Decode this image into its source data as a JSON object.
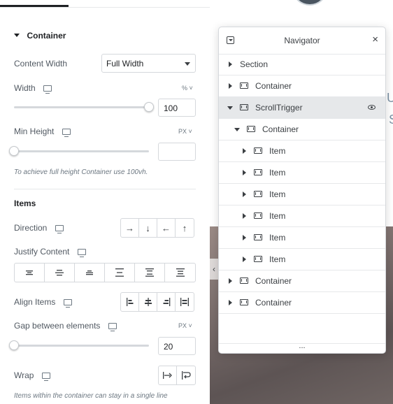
{
  "panel": {
    "section_title": "Container",
    "content_width": {
      "label": "Content Width",
      "value": "Full Width"
    },
    "width": {
      "label": "Width",
      "unit": "%",
      "value": "100",
      "slider_fraction": 1.0
    },
    "min_height": {
      "label": "Min Height",
      "unit": "PX",
      "value": "",
      "slider_fraction": 0.0
    },
    "min_height_hint": "To achieve full height Container use 100vh.",
    "items_title": "Items",
    "direction_label": "Direction",
    "direction_icons": [
      "arrow-right-icon",
      "arrow-down-icon",
      "arrow-left-icon",
      "arrow-up-icon"
    ],
    "direction_glyphs": [
      "→",
      "↓",
      "←",
      "↑"
    ],
    "justify_label": "Justify Content",
    "justify_icons": [
      "justify-start-icon",
      "justify-center-icon",
      "justify-end-icon",
      "justify-space-between-icon",
      "justify-space-around-icon",
      "justify-space-evenly-icon"
    ],
    "align_label": "Align Items",
    "align_icons": [
      "align-start-icon",
      "align-center-icon",
      "align-end-icon",
      "align-stretch-icon"
    ],
    "gap_label": "Gap between elements",
    "gap": {
      "unit": "PX",
      "value": "20",
      "slider_fraction": 0.0
    },
    "wrap_label": "Wrap",
    "wrap_icons": [
      "no-wrap-icon",
      "wrap-icon"
    ],
    "wrap_hint": "Items within the container can stay in a single line"
  },
  "navigator": {
    "title": "Navigator",
    "close": "×",
    "more": "...",
    "rows": [
      {
        "label": "Section",
        "expanded": false
      },
      {
        "label": "Container",
        "expanded": false
      },
      {
        "label": "ScrollTrigger",
        "expanded": true,
        "active": true
      },
      {
        "label": "Container",
        "expanded": true
      },
      {
        "label": "Item",
        "expanded": false
      },
      {
        "label": "Item",
        "expanded": false
      },
      {
        "label": "Item",
        "expanded": false
      },
      {
        "label": "Item",
        "expanded": false
      },
      {
        "label": "Item",
        "expanded": false
      },
      {
        "label": "Item",
        "expanded": false
      },
      {
        "label": "Container",
        "expanded": false
      },
      {
        "label": "Container",
        "expanded": false
      }
    ]
  },
  "canvas": {
    "peek_text_1": "U",
    "peek_text_2": "S",
    "toggle": "‹"
  },
  "colors": {
    "accent": "#1f2124",
    "border": "#d5d8dc",
    "active_row": "#e6e8ea"
  }
}
